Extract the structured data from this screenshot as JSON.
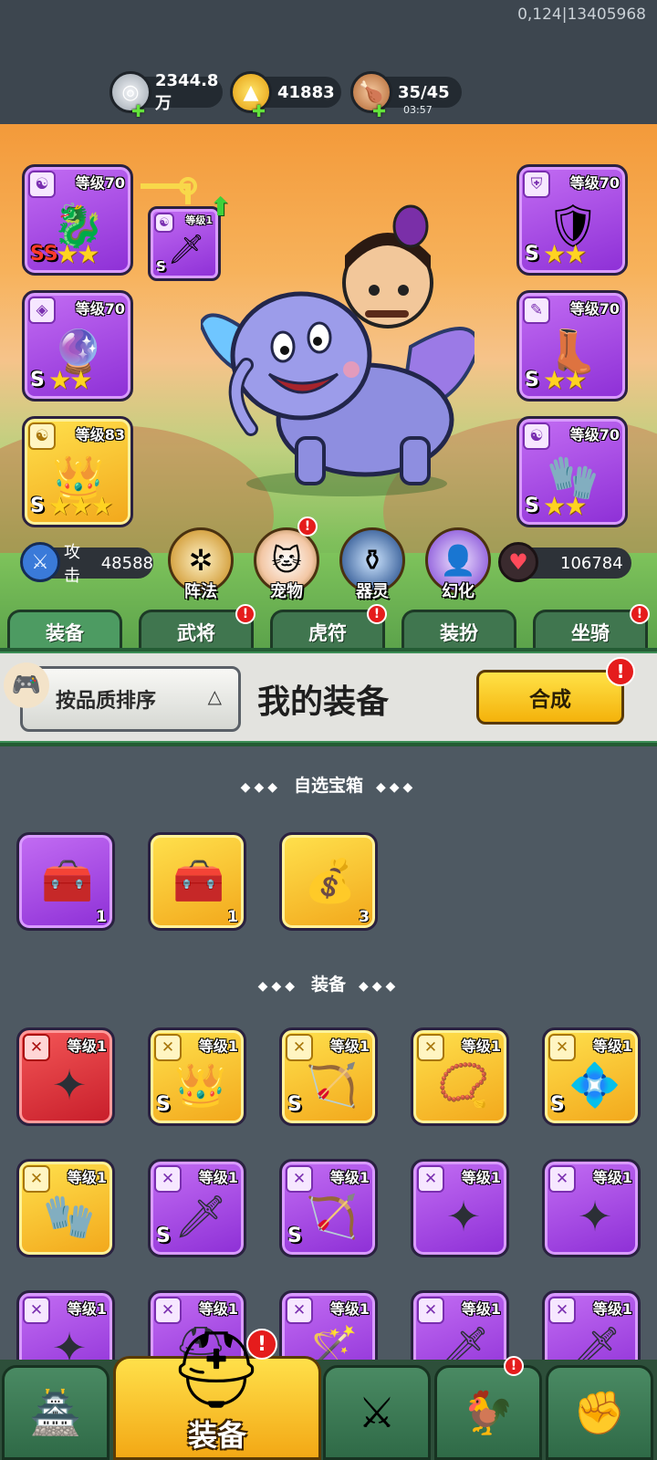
{
  "build_id": "0,124|13405968",
  "resources": {
    "silver": "2344.8万",
    "gold": "41883",
    "stamina": "35/45",
    "stamina_timer": "03:57"
  },
  "hero_slots": {
    "left": [
      {
        "level": "等级70",
        "grade": "SS",
        "stars": "★★"
      },
      {
        "level": "等级70",
        "grade": "S",
        "stars": "★★"
      },
      {
        "level": "等级83",
        "grade": "S",
        "stars": "★★★"
      }
    ],
    "right": [
      {
        "level": "等级70",
        "grade": "S",
        "stars": "★★"
      },
      {
        "level": "等级70",
        "grade": "S",
        "stars": "★★"
      },
      {
        "level": "等级70",
        "grade": "S",
        "stars": "★★"
      }
    ],
    "small": {
      "level": "等级1",
      "grade": "S"
    }
  },
  "stats": {
    "attack_label": "攻击",
    "attack_value": "48588",
    "hp_value": "106784"
  },
  "round_buttons": [
    "阵法",
    "宠物",
    "器灵",
    "幻化"
  ],
  "tabs": [
    "装备",
    "武将",
    "虎符",
    "装扮",
    "坐骑"
  ],
  "panel": {
    "sort_label": "按品质排序",
    "title": "我的装备",
    "merge_label": "合成"
  },
  "sections": {
    "chests": "自选宝箱",
    "equipment": "装备"
  },
  "chests": [
    {
      "count": "1",
      "color": "purple"
    },
    {
      "count": "1",
      "color": "gold"
    },
    {
      "count": "3",
      "color": "gold"
    }
  ],
  "equipment_rows": [
    [
      {
        "level": "等级1",
        "color": "red",
        "grade": ""
      },
      {
        "level": "等级1",
        "color": "gold",
        "grade": "S"
      },
      {
        "level": "等级1",
        "color": "gold",
        "grade": "S"
      },
      {
        "level": "等级1",
        "color": "gold",
        "grade": ""
      },
      {
        "level": "等级1",
        "color": "gold",
        "grade": "S"
      }
    ],
    [
      {
        "level": "等级1",
        "color": "gold",
        "grade": ""
      },
      {
        "level": "等级1",
        "color": "purple",
        "grade": "S"
      },
      {
        "level": "等级1",
        "color": "purple",
        "grade": "S"
      },
      {
        "level": "等级1",
        "color": "purple",
        "grade": ""
      },
      {
        "level": "等级1",
        "color": "purple",
        "grade": ""
      }
    ],
    [
      {
        "level": "等级1",
        "color": "purple",
        "grade": ""
      },
      {
        "level": "等级1",
        "color": "purple",
        "grade": ""
      },
      {
        "level": "等级1",
        "color": "purple",
        "grade": ""
      },
      {
        "level": "等级1",
        "color": "purple",
        "grade": ""
      },
      {
        "level": "等级1",
        "color": "purple",
        "grade": ""
      }
    ]
  ],
  "bottom_nav": {
    "active_label": "装备"
  },
  "alert_mark": "!",
  "icons": {
    "silver": "silver-coin-icon",
    "gold": "gold-ingot-icon",
    "stamina": "meat-drumstick-icon",
    "attack": "sword-icon",
    "hp": "heart-icon"
  }
}
